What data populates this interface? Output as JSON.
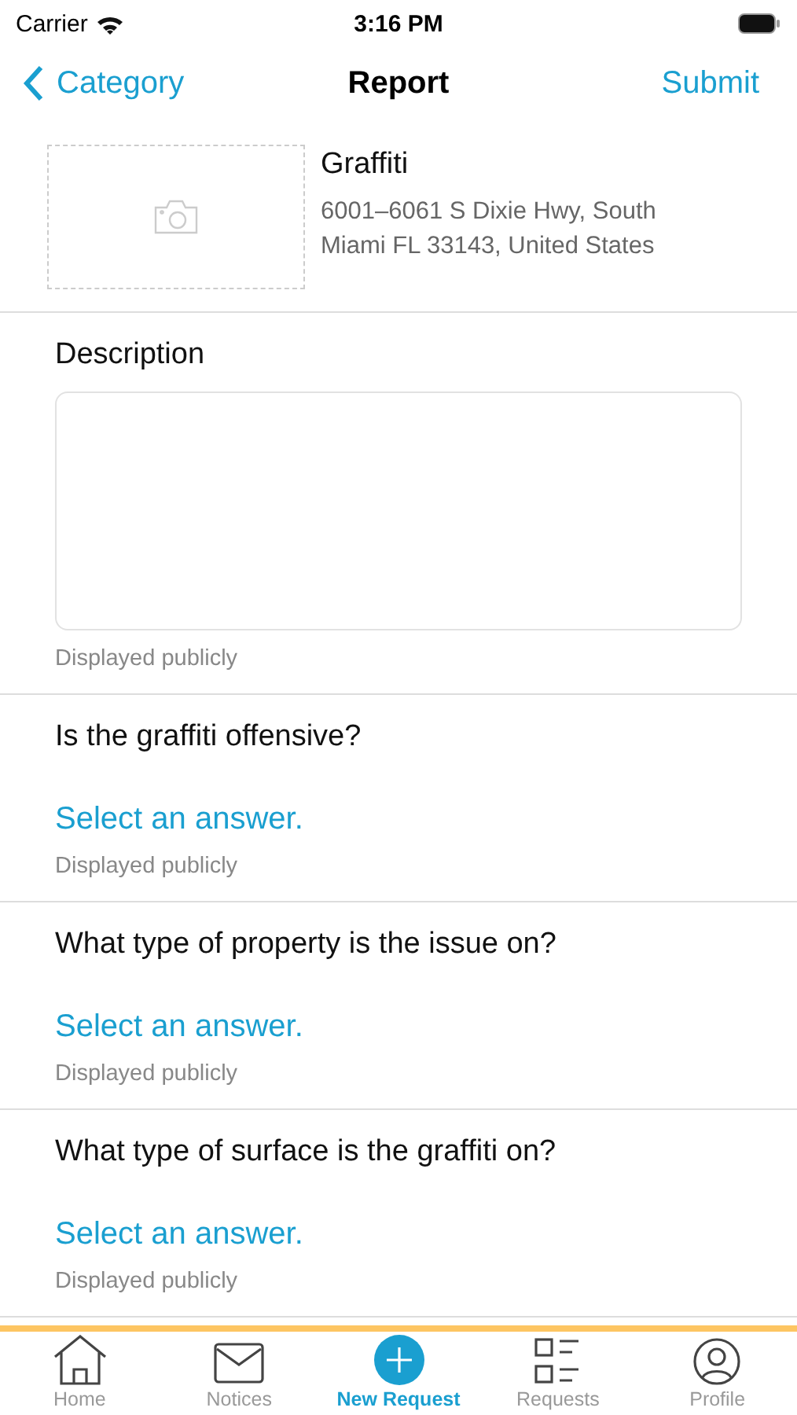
{
  "status_bar": {
    "carrier": "Carrier",
    "time": "3:16 PM"
  },
  "nav": {
    "back": "Category",
    "title": "Report",
    "action": "Submit"
  },
  "report": {
    "category": "Graffiti",
    "address": "6001–6061 S Dixie Hwy, South Miami FL 33143, United States"
  },
  "description": {
    "label": "Description",
    "hint": "Displayed publicly"
  },
  "questions": [
    {
      "question": "Is the graffiti offensive?",
      "answer": "Select an answer.",
      "hint": "Displayed publicly"
    },
    {
      "question": "What type of property is the issue on?",
      "answer": "Select an answer.",
      "hint": "Displayed publicly"
    },
    {
      "question": "What type of surface is the graffiti on?",
      "answer": "Select an answer.",
      "hint": "Displayed publicly"
    }
  ],
  "tab_bar": [
    {
      "kind": "home",
      "label": "Home",
      "selected": false
    },
    {
      "kind": "notices",
      "label": "Notices",
      "selected": false
    },
    {
      "kind": "new",
      "label": "New Request",
      "selected": true
    },
    {
      "kind": "requests",
      "label": "Requests",
      "selected": false
    },
    {
      "kind": "profile",
      "label": "Profile",
      "selected": false
    }
  ]
}
